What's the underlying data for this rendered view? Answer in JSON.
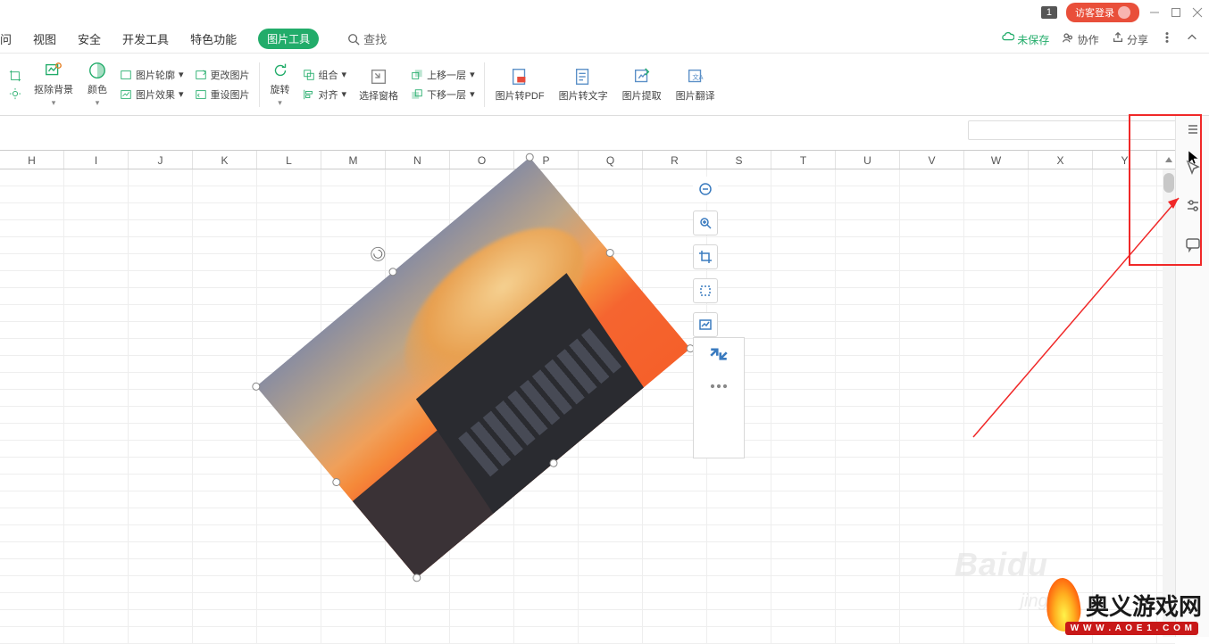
{
  "titlebar": {
    "badge": "1",
    "login": "访客登录"
  },
  "menu": {
    "items": [
      "视图",
      "安全",
      "开发工具",
      "特色功能"
    ],
    "partial_first": "问",
    "pill": "图片工具",
    "search": "查找",
    "unsaved": "未保存",
    "collaborate": "协作",
    "share": "分享"
  },
  "ribbon": {
    "removebg": "抠除背景",
    "color": "颜色",
    "outline": "图片轮廓",
    "effect": "图片效果",
    "change": "更改图片",
    "reset": "重设图片",
    "rotate": "旋转",
    "group": "组合",
    "align": "对齐",
    "selectpane": "选择窗格",
    "up": "上移一层",
    "down": "下移一层",
    "topdf": "图片转PDF",
    "totext": "图片转文字",
    "extract": "图片提取",
    "translate": "图片翻译"
  },
  "columns": [
    "H",
    "I",
    "J",
    "K",
    "L",
    "M",
    "N",
    "O",
    "P",
    "Q",
    "R",
    "S",
    "T",
    "U",
    "V",
    "W",
    "X",
    "Y"
  ],
  "watermark": {
    "main": "Baidu",
    "sub": "jingyan"
  },
  "site": {
    "name": "奥义游戏网",
    "url": "W W W . A O E 1 . C O M"
  }
}
